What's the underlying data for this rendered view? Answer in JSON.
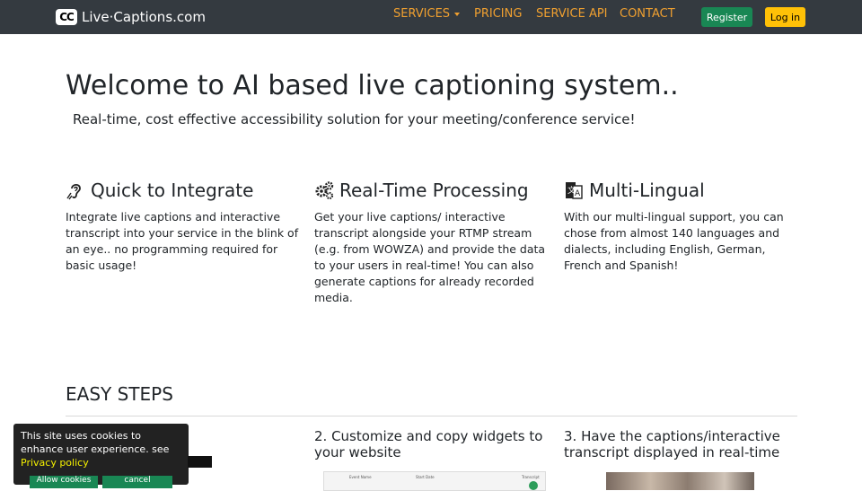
{
  "navbar": {
    "logo_text": "CC",
    "brand": "Live·Captions.com",
    "links": [
      {
        "label": "SERVICES",
        "has_dropdown": true
      },
      {
        "label": "PRICING"
      },
      {
        "label": "SERVICE API"
      },
      {
        "label": "CONTACT"
      }
    ],
    "register_label": "Register",
    "login_label": "Log in",
    "link_color": "#f0a030"
  },
  "hero": {
    "title": "Welcome to AI based live captioning system..",
    "subtitle": "Real-time, cost effective accessibility solution for your meeting/conference service!"
  },
  "features": [
    {
      "icon": "ear-icon",
      "title": "Quick to Integrate",
      "text": "Integrate live captions and interactive transcript into your service in the blink of an eye.. no programming required for basic usage!"
    },
    {
      "icon": "gears-icon",
      "title": "Real-Time Processing",
      "text": "Get your live captions/ interactive transcript alongside your RTMP stream (e.g. from WOWZA) and provide the data to your users in real-time! You can also generate captions for already recorded media."
    },
    {
      "icon": "language-icon",
      "title": "Multi-Lingual",
      "text": "With our multi-lingual support, you can chose from almost 140 languages and dialects, including English, German, French and Spanish!"
    }
  ],
  "steps": {
    "title": "EASY STEPS",
    "items": [
      {
        "label": "2. Customize and copy widgets to your website"
      },
      {
        "label": "3. Have the captions/interactive transcript displayed in real-time"
      }
    ],
    "widget_columns": [
      "Event Name",
      "Start Date",
      "Transcript"
    ]
  },
  "cookie": {
    "text": "This site uses cookies to enhance user experience. see ",
    "link": "Privacy policy",
    "allow_label": "Allow cookies",
    "cancel_label": "cancel"
  },
  "colors": {
    "navbar_bg": "#343a40",
    "register_bg": "#198754",
    "login_bg": "#ffc107",
    "cookie_link": "#f4f000"
  }
}
